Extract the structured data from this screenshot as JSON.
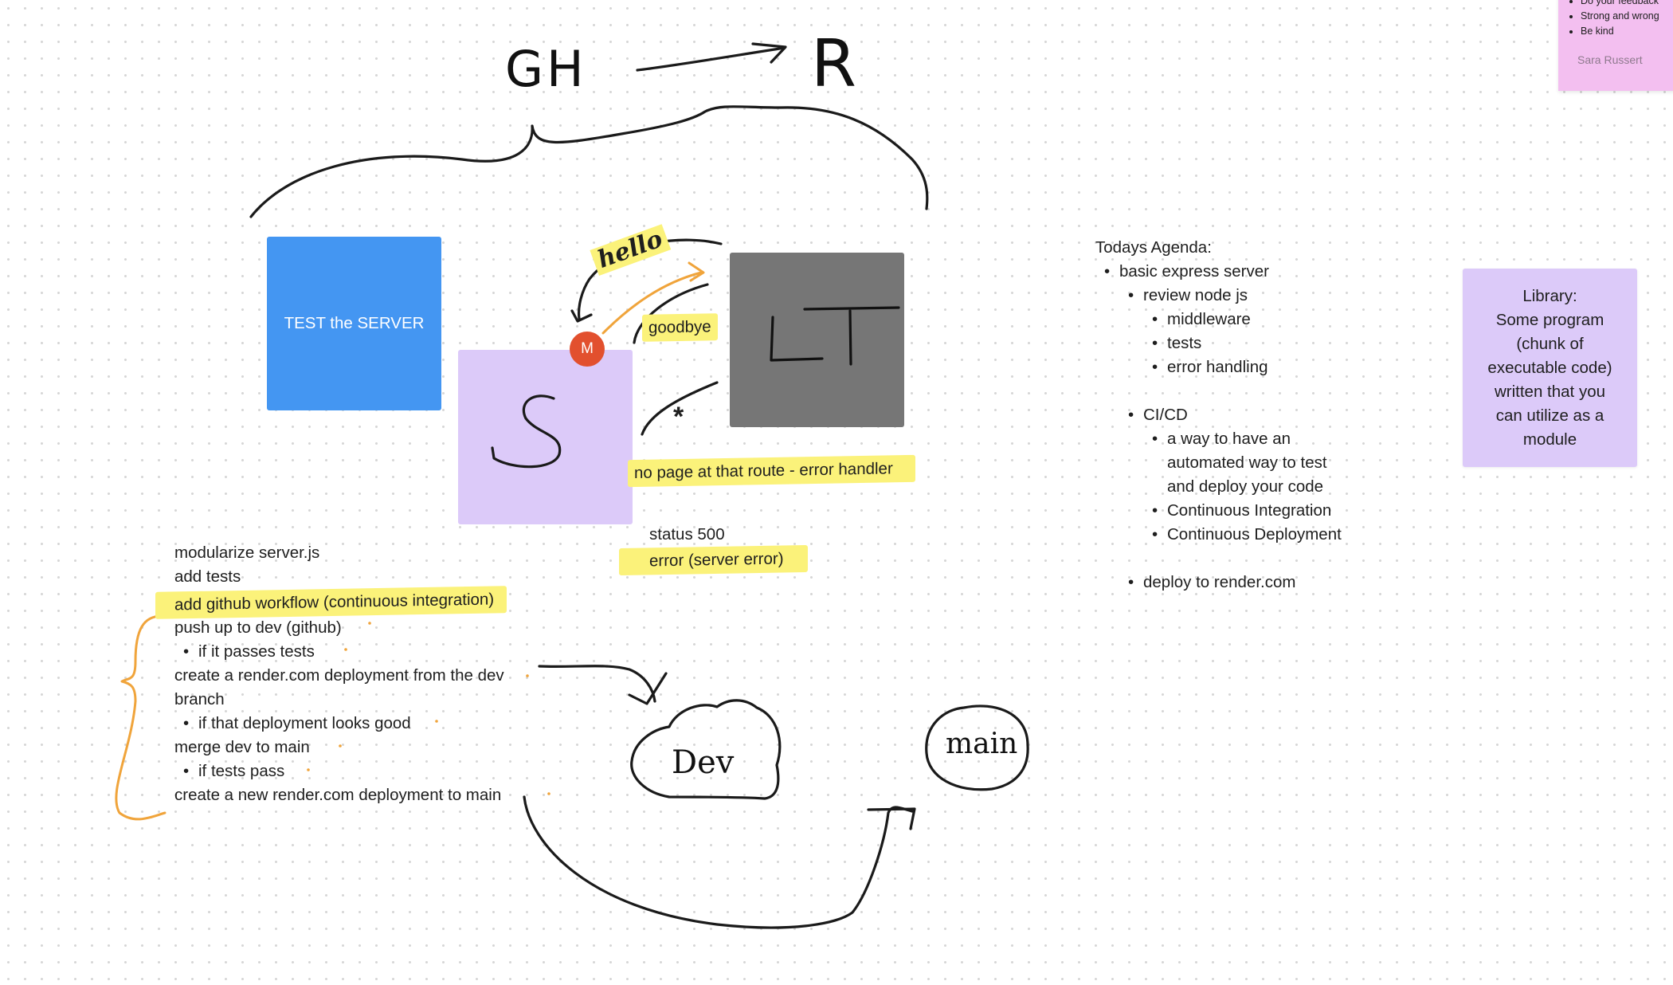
{
  "whiteboard": {
    "handwriting": {
      "gh": "GH",
      "r": "R",
      "s": "S",
      "lt": "LT",
      "hello": "hello",
      "asterisk": "*",
      "dev": "Dev",
      "main": "main"
    },
    "test_card": {
      "label": "TEST the SERVER"
    },
    "avatar_badge": {
      "initial": "M"
    },
    "route_labels": {
      "goodbye": "goodbye",
      "error_handler": "no page at that route - error handler",
      "status_line1": "status 500",
      "status_line2": "error (server error)"
    },
    "steps": [
      "modularize server.js",
      "add tests",
      "add github workflow (continuous integration)",
      "push up to dev (github)",
      "if it passes tests",
      "create a render.com deployment from the dev",
      "branch",
      "if that deployment looks good",
      "merge dev to main",
      "if tests pass",
      "create a new render.com deployment to main"
    ],
    "agenda": {
      "title": "Todays Agenda:",
      "items": [
        "basic express server",
        "review node js",
        "middleware",
        "tests",
        "error handling",
        "CI/CD",
        "a way to have an",
        "automated way to test",
        "and deploy your code",
        "Continuous Integration",
        "Continuous Deployment",
        "deploy to render.com"
      ]
    },
    "library_note": {
      "lines": [
        "Library:",
        "Some program",
        "(chunk of",
        "executable code)",
        "written that you",
        "can utilize as a",
        "module"
      ]
    },
    "feedback_note": {
      "lines": [
        "Do your feedback",
        "Strong and wrong",
        "Be kind"
      ],
      "author": "Sara Russert"
    },
    "colors": {
      "canvas": "#ffffff",
      "dot_grid": "#d6d6d6",
      "blue_card": "#4496f2",
      "purple_card": "#dccaf9",
      "gray_card": "#767676",
      "badge": "#e2502e",
      "highlight": "#fbf27a",
      "orange_ink": "#f0a43b",
      "pink_note": "#f3bff0"
    }
  }
}
